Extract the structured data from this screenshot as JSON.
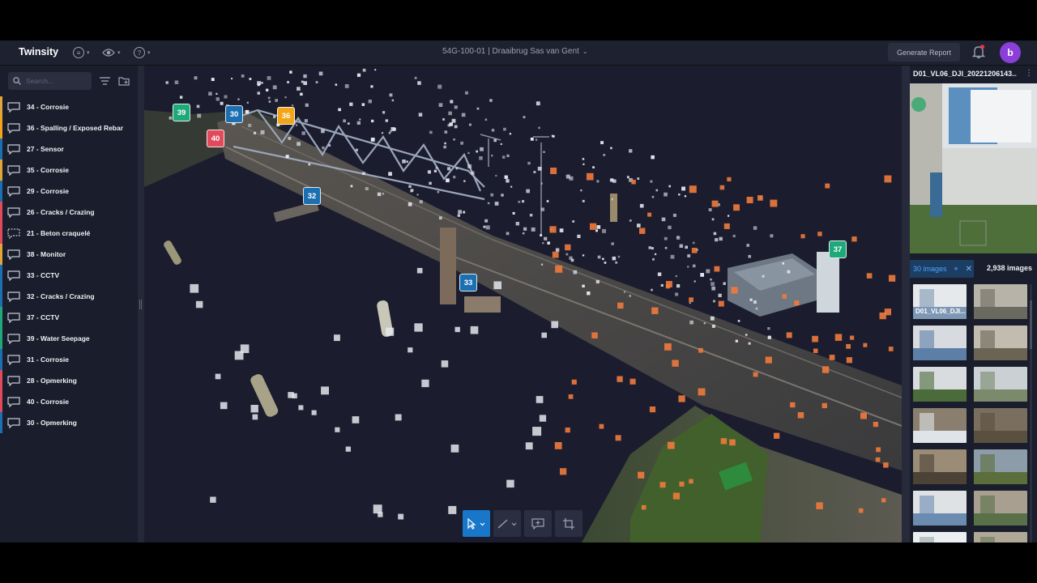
{
  "app": {
    "brand": "Twinsity"
  },
  "header": {
    "project_title": "54G-100-01 | Draaibrug Sas van Gent",
    "generate_report": "Generate Report",
    "avatar_initial": "b",
    "icons": [
      "layers-icon",
      "eye-icon",
      "help-icon",
      "bell-icon"
    ]
  },
  "sidebar": {
    "search_placeholder": "Search...",
    "items": [
      {
        "label": "34 - Corrosie",
        "color": "#e0a63a"
      },
      {
        "label": "36 - Spalling / Exposed Rebar",
        "color": "#f2a51a"
      },
      {
        "label": "27 - Sensor",
        "color": "#1c6fb0"
      },
      {
        "label": "35 - Corrosie",
        "color": "#e0a63a"
      },
      {
        "label": "29 - Corrosie",
        "color": "#1c6fb0"
      },
      {
        "label": "26 - Cracks / Crazing",
        "color": "#e04a5a"
      },
      {
        "label": "21 - Beton craquelé",
        "color": "#e04a5a"
      },
      {
        "label": "38 - Monitor",
        "color": "#e0a63a"
      },
      {
        "label": "33 - CCTV",
        "color": "#1c6fb0"
      },
      {
        "label": "32 - Cracks / Crazing",
        "color": "#1c6fb0"
      },
      {
        "label": "37 - CCTV",
        "color": "#1fa97b"
      },
      {
        "label": "39 - Water Seepage",
        "color": "#1fa97b"
      },
      {
        "label": "31 - Corrosie",
        "color": "#1c6fb0"
      },
      {
        "label": "28 - Opmerking",
        "color": "#e04a5a"
      },
      {
        "label": "40 - Corrosie",
        "color": "#e04a5a"
      },
      {
        "label": "30 - Opmerking",
        "color": "#1c6fb0"
      }
    ]
  },
  "viewport": {
    "markers": [
      {
        "label": "39",
        "color": "#1fa97b"
      },
      {
        "label": "30",
        "color": "#1c6fb0"
      },
      {
        "label": "36",
        "color": "#f2a51a"
      },
      {
        "label": "40",
        "color": "#e04a5a"
      },
      {
        "label": "32",
        "color": "#1c6fb0"
      },
      {
        "label": "33",
        "color": "#1c6fb0"
      },
      {
        "label": "37",
        "color": "#1fa97b"
      }
    ],
    "tools": [
      "select-tool",
      "measure-tool",
      "annotate-tool",
      "crop-tool"
    ]
  },
  "right_panel": {
    "image_name": "D01_VL06_DJI_20221206143...",
    "tab_images": "30 images",
    "tab_total": "2,938 images",
    "first_thumb_label": "D01_VL06_DJI..."
  }
}
